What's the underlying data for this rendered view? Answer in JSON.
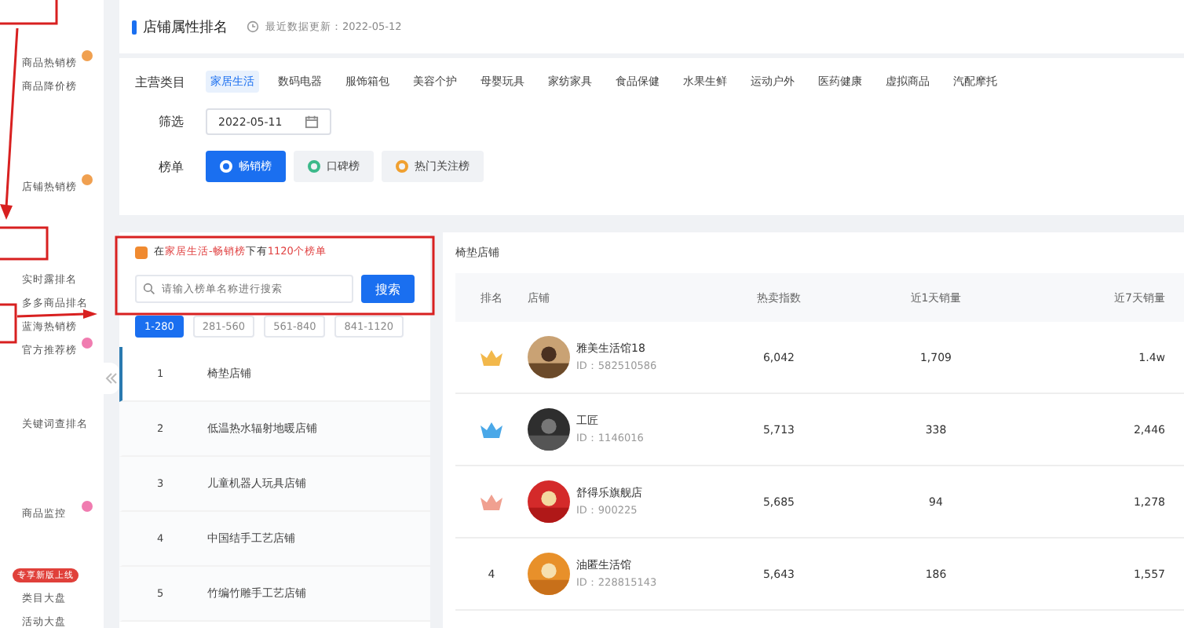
{
  "sidebar": {
    "groups": [
      {
        "items": [
          {
            "label": "商品热销榜",
            "color": "#f0a050"
          },
          {
            "label": "商品降价榜"
          }
        ]
      },
      {
        "items": [
          {
            "label": "店铺热销榜",
            "color": "#f0a050"
          }
        ]
      },
      {
        "items": [
          {
            "label": "实时露排名"
          },
          {
            "label": "多多商品排名"
          },
          {
            "label": "蓝海热销榜"
          },
          {
            "label": "官方推荐榜",
            "color": "#f07cb0"
          }
        ]
      },
      {
        "items": [
          {
            "label": "关键词查排名"
          }
        ]
      },
      {
        "items": [
          {
            "label": "商品监控",
            "color": "#f07cb0"
          }
        ]
      },
      {
        "header_badge": "专享新版上线",
        "items": [
          {
            "label": "类目大盘"
          },
          {
            "label": "活动大盘"
          }
        ]
      }
    ]
  },
  "page_header": {
    "title": "店铺属性排名",
    "updated": "最近数据更新：2022-05-12"
  },
  "filters": {
    "category_label": "主营类目",
    "categories": [
      {
        "label": "家居生活",
        "selected": true
      },
      {
        "label": "数码电器",
        "selected": false
      },
      {
        "label": "服饰箱包",
        "selected": false
      },
      {
        "label": "美容个护",
        "selected": false
      },
      {
        "label": "母婴玩具",
        "selected": false
      },
      {
        "label": "家纺家具",
        "selected": false
      },
      {
        "label": "食品保健",
        "selected": false
      },
      {
        "label": "水果生鲜",
        "selected": false
      },
      {
        "label": "运动户外",
        "selected": false
      },
      {
        "label": "医药健康",
        "selected": false
      },
      {
        "label": "虚拟商品",
        "selected": false
      },
      {
        "label": "汽配摩托",
        "selected": false
      }
    ],
    "date_label": "筛选",
    "date": "2022-05-11",
    "board_label": "榜单",
    "boards": [
      {
        "label": "畅销榜",
        "selected": true,
        "color": "#ffffff"
      },
      {
        "label": "口碑榜",
        "selected": false,
        "color": "#3cb98a"
      },
      {
        "label": "热门关注榜",
        "selected": false,
        "color": "#f0a030"
      }
    ]
  },
  "list_panel": {
    "summary": "在**家居生活-畅销榜**下有**1120个榜单**",
    "search_placeholder": "请输入榜单名称进行搜索",
    "search_button": "搜索",
    "ranges": [
      {
        "label": "1-280",
        "selected": true
      },
      {
        "label": "281-560",
        "selected": false
      },
      {
        "label": "561-840",
        "selected": false
      },
      {
        "label": "841-1120",
        "selected": false
      }
    ],
    "items": [
      {
        "index": "1",
        "name": "椅垫店铺",
        "selected": true
      },
      {
        "index": "2",
        "name": "低温热水辐射地暖店铺",
        "selected": false
      },
      {
        "index": "3",
        "name": "儿童机器人玩具店铺",
        "selected": false
      },
      {
        "index": "4",
        "name": "中国结手工艺店铺",
        "selected": false
      },
      {
        "index": "5",
        "name": "竹编竹雕手工艺店铺",
        "selected": false
      }
    ]
  },
  "table": {
    "title": "椅垫店铺",
    "columns": [
      "排名",
      "店铺",
      "热卖指数",
      "近1天销量",
      "近7天销量"
    ],
    "rows": [
      {
        "kind": "crown",
        "color": "#f2b84b",
        "name": "雅美生活馆18",
        "id": "ID：582510586",
        "hot": "6,042",
        "day1": "1,709",
        "day7": "1.4w"
      },
      {
        "kind": "crown",
        "color": "#4aa8e8",
        "name": "工匠",
        "id": "ID：1146016",
        "hot": "5,713",
        "day1": "338",
        "day7": "2,446"
      },
      {
        "kind": "crown",
        "color": "#f0a090",
        "name": "舒得乐旗舰店",
        "id": "ID：900225",
        "hot": "5,685",
        "day1": "94",
        "day7": "1,278"
      },
      {
        "kind": "number",
        "rank": "4",
        "name": "油匿生活馆",
        "id": "ID：228815143",
        "hot": "5,643",
        "day1": "186",
        "day7": "1,557"
      }
    ]
  }
}
